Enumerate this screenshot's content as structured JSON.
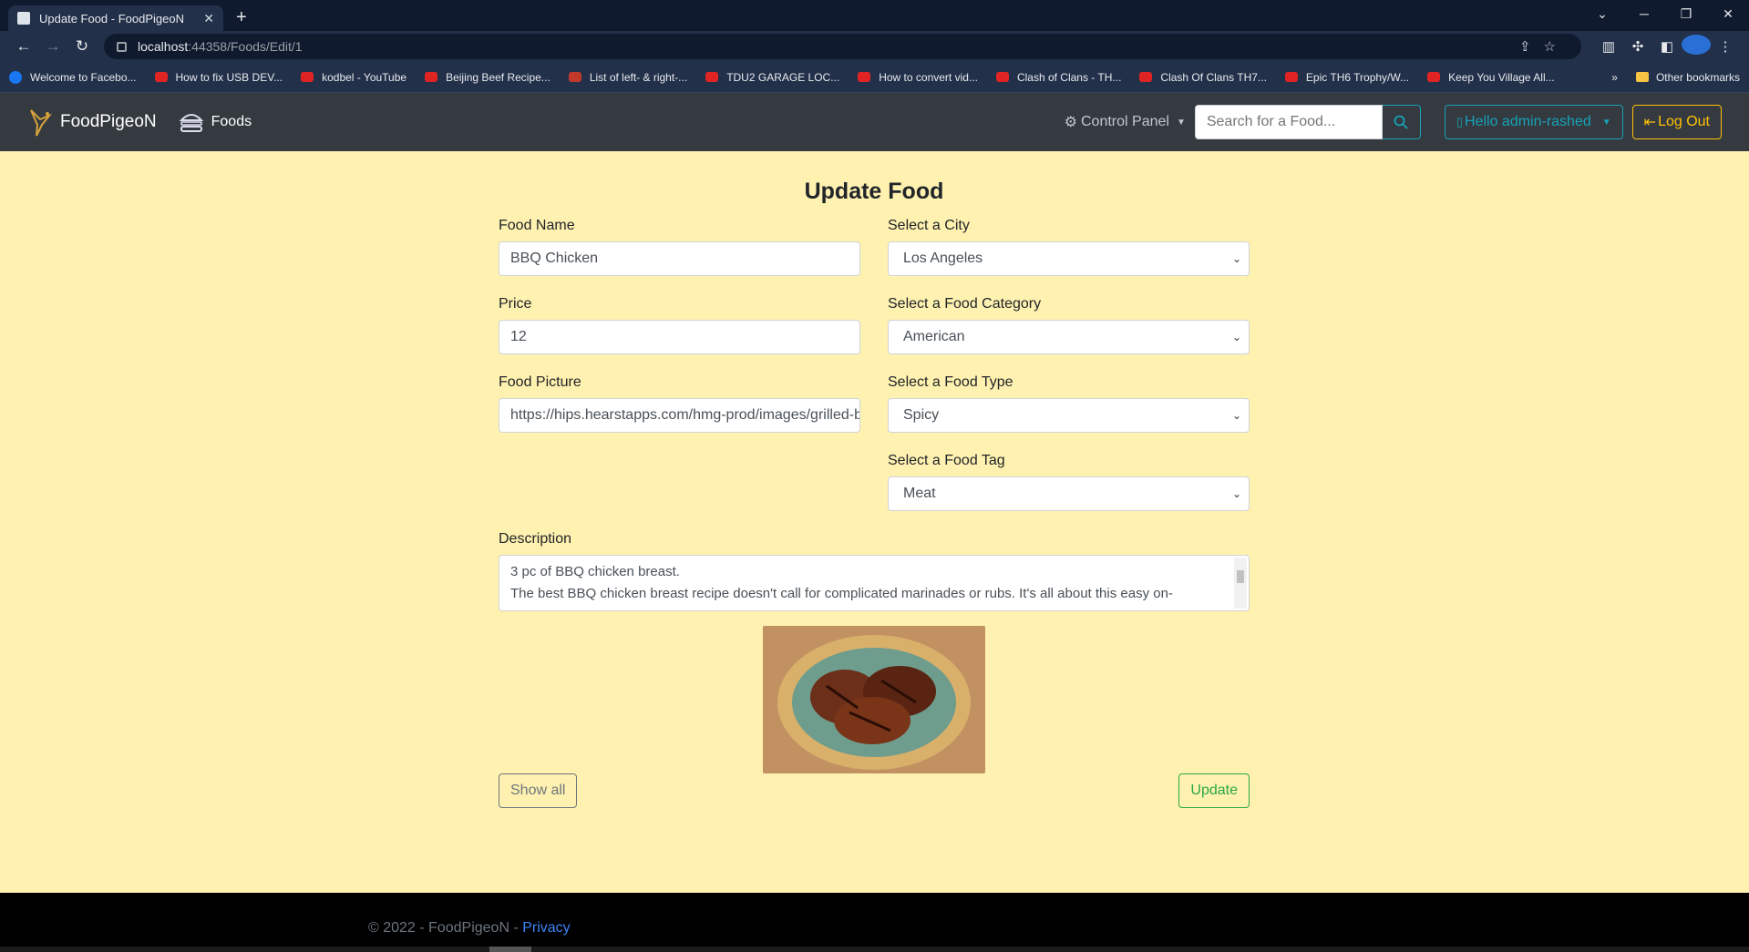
{
  "browser": {
    "tab_title": "Update Food - FoodPigeoN",
    "url_host": "localhost",
    "url_path": ":44358/Foods/Edit/1",
    "bookmarks": [
      {
        "label": "Welcome to Facebo...",
        "icon": "facebook-icon"
      },
      {
        "label": "How to fix USB DEV...",
        "icon": "youtube-icon"
      },
      {
        "label": "kodbel - YouTube",
        "icon": "youtube-icon"
      },
      {
        "label": "Beijing Beef Recipe...",
        "icon": "youtube-icon"
      },
      {
        "label": "List of left- & right-...",
        "icon": "wiki-icon"
      },
      {
        "label": "TDU2 GARAGE LOC...",
        "icon": "youtube-icon"
      },
      {
        "label": "How to convert vid...",
        "icon": "youtube-icon"
      },
      {
        "label": "Clash of Clans - TH...",
        "icon": "youtube-icon"
      },
      {
        "label": "Clash Of Clans TH7...",
        "icon": "youtube-icon"
      },
      {
        "label": "Epic TH6 Trophy/W...",
        "icon": "youtube-icon"
      },
      {
        "label": "Keep You Village All...",
        "icon": "youtube-icon"
      }
    ],
    "more_bookmarks": "»",
    "other_bookmarks": "Other bookmarks"
  },
  "nav": {
    "brand": "FoodPigeoN",
    "foods_link": "Foods",
    "control_panel": "Control Panel",
    "search_placeholder": "Search for a Food...",
    "user_greeting": "Hello admin-rashed",
    "logout": "Log Out"
  },
  "form": {
    "title": "Update Food",
    "food_name_label": "Food Name",
    "food_name_value": "BBQ Chicken",
    "price_label": "Price",
    "price_value": "12",
    "picture_label": "Food Picture",
    "picture_value": "https://hips.hearstapps.com/hmg-prod/images/grilled-bbq-chicken",
    "city_label": "Select a City",
    "city_value": "Los Angeles",
    "category_label": "Select a Food Category",
    "category_value": "American",
    "type_label": "Select a Food Type",
    "type_value": "Spicy",
    "tag_label": "Select a Food Tag",
    "tag_value": "Meat",
    "description_label": "Description",
    "description_line1": "3 pc of BBQ chicken breast.",
    "description_line2": "The best BBQ chicken breast recipe doesn't call for complicated marinades or rubs. It's all about this easy on-",
    "show_all": "Show all",
    "update": "Update"
  },
  "footer": {
    "copyright": "© 2022 - FoodPigeoN - ",
    "privacy": "Privacy"
  },
  "colors": {
    "page_bg": "#fff1b0",
    "navbar_bg": "#343a40",
    "info": "#17a2b8",
    "warning": "#ffc107",
    "success": "#28a745",
    "secondary": "#6c757d"
  }
}
